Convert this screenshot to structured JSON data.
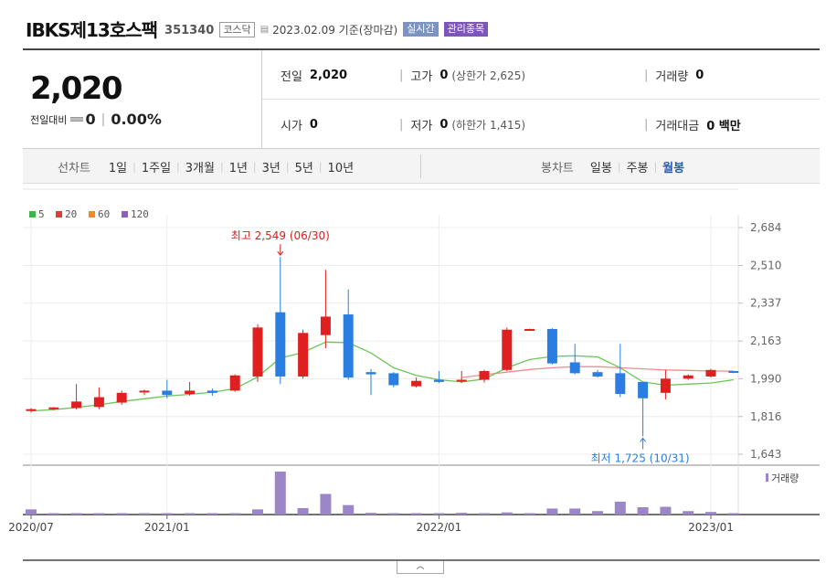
{
  "header": {
    "name": "IBKS제13호스팩",
    "code": "351340",
    "market": "코스닥",
    "date": "2023.02.09 기준(장마감)",
    "badge_realtime": "실시간",
    "badge_managed": "관리종목"
  },
  "quote": {
    "price": "2,020",
    "change_label": "전일대비",
    "change_value": "0",
    "change_separator": "|",
    "change_pct": "0.00%",
    "prev_close_label": "전일",
    "prev_close": "2,020",
    "high_label": "고가",
    "high": "0",
    "upper_limit": "(상한가 2,625)",
    "volume_label": "거래량",
    "volume": "0",
    "open_label": "시가",
    "open": "0",
    "low_label": "저가",
    "low": "0",
    "lower_limit": "(하한가 1,415)",
    "trade_value_label": "거래대금",
    "trade_value": "0 백만"
  },
  "period": {
    "line_label": "선차트",
    "line_items": [
      "1일",
      "1주일",
      "3개월",
      "1년",
      "3년",
      "5년",
      "10년"
    ],
    "candle_label": "봉차트",
    "candle_items": [
      "일봉",
      "주봉",
      "월봉"
    ],
    "active_candle": "월봉",
    "expand_icon": "chevron-up-icon"
  },
  "chart_data": {
    "type": "candlestick",
    "legend": [
      {
        "name": "5",
        "color": "#3cb54a"
      },
      {
        "name": "20",
        "color": "#e53935"
      },
      {
        "name": "60",
        "color": "#f5891f"
      },
      {
        "name": "120",
        "color": "#8e5bc7"
      }
    ],
    "up_color": "#e02020",
    "down_color": "#2a7de1",
    "y_ticks": [
      1643,
      1816,
      1990,
      2163,
      2337,
      2510,
      2684
    ],
    "y_tick_labels": [
      "1,643",
      "1,816",
      "1,990",
      "2,163",
      "2,337",
      "2,510",
      "2,684"
    ],
    "ylim": [
      1643,
      2684
    ],
    "x_labels": [
      {
        "index": 0,
        "label": "2020/07"
      },
      {
        "index": 6,
        "label": "2021/01"
      },
      {
        "index": 18,
        "label": "2022/01"
      },
      {
        "index": 30,
        "label": "2023/01"
      }
    ],
    "candles": [
      {
        "o": 1845,
        "h": 1855,
        "l": 1835,
        "c": 1850
      },
      {
        "o": 1850,
        "h": 1860,
        "l": 1845,
        "c": 1858
      },
      {
        "o": 1855,
        "h": 1965,
        "l": 1848,
        "c": 1885
      },
      {
        "o": 1860,
        "h": 1950,
        "l": 1850,
        "c": 1905
      },
      {
        "o": 1880,
        "h": 1935,
        "l": 1870,
        "c": 1925
      },
      {
        "o": 1930,
        "h": 1940,
        "l": 1915,
        "c": 1935
      },
      {
        "o": 1935,
        "h": 1985,
        "l": 1900,
        "c": 1915
      },
      {
        "o": 1920,
        "h": 1975,
        "l": 1912,
        "c": 1935
      },
      {
        "o": 1935,
        "h": 1945,
        "l": 1912,
        "c": 1925
      },
      {
        "o": 1935,
        "h": 2010,
        "l": 1930,
        "c": 2005
      },
      {
        "o": 2000,
        "h": 2240,
        "l": 1975,
        "c": 2225
      },
      {
        "o": 2295,
        "h": 2549,
        "l": 1965,
        "c": 2000
      },
      {
        "o": 2000,
        "h": 2215,
        "l": 1990,
        "c": 2200
      },
      {
        "o": 2190,
        "h": 2490,
        "l": 2130,
        "c": 2275
      },
      {
        "o": 2285,
        "h": 2400,
        "l": 1985,
        "c": 1995
      },
      {
        "o": 2020,
        "h": 2035,
        "l": 1915,
        "c": 2010
      },
      {
        "o": 2015,
        "h": 2020,
        "l": 1950,
        "c": 1960
      },
      {
        "o": 1955,
        "h": 1995,
        "l": 1950,
        "c": 1980
      },
      {
        "o": 1985,
        "h": 2025,
        "l": 1970,
        "c": 1975
      },
      {
        "o": 1980,
        "h": 2025,
        "l": 1970,
        "c": 1985
      },
      {
        "o": 1985,
        "h": 2030,
        "l": 1972,
        "c": 2025
      },
      {
        "o": 2030,
        "h": 2225,
        "l": 2025,
        "c": 2215
      },
      {
        "o": 2215,
        "h": 2220,
        "l": 2210,
        "c": 2218
      },
      {
        "o": 2218,
        "h": 2222,
        "l": 2055,
        "c": 2060
      },
      {
        "o": 2065,
        "h": 2150,
        "l": 2010,
        "c": 2015
      },
      {
        "o": 2020,
        "h": 2030,
        "l": 1995,
        "c": 2000
      },
      {
        "o": 2015,
        "h": 2150,
        "l": 1905,
        "c": 1920
      },
      {
        "o": 1975,
        "h": 1975,
        "l": 1725,
        "c": 1900
      },
      {
        "o": 1925,
        "h": 2030,
        "l": 1895,
        "c": 1990
      },
      {
        "o": 1990,
        "h": 2010,
        "l": 1985,
        "c": 2005
      },
      {
        "o": 2000,
        "h": 2035,
        "l": 1995,
        "c": 2030
      },
      {
        "o": 2025,
        "h": 2025,
        "l": 2015,
        "c": 2020
      }
    ],
    "ma5": [
      1842,
      1848,
      1858,
      1870,
      1885,
      1898,
      1910,
      1918,
      1928,
      1944,
      1998,
      2085,
      2110,
      2158,
      2155,
      2108,
      2040,
      2005,
      1985,
      1975,
      1988,
      2040,
      2078,
      2092,
      2095,
      2090,
      2040,
      1975,
      1960,
      1965,
      1970,
      1985
    ],
    "ma20": [
      null,
      null,
      null,
      null,
      null,
      null,
      null,
      null,
      null,
      null,
      null,
      null,
      null,
      null,
      null,
      null,
      null,
      null,
      null,
      1995,
      2008,
      2020,
      2032,
      2040,
      2045,
      2045,
      2040,
      2035,
      2030,
      2028,
      2025,
      2025
    ],
    "max_label": "최고 2,549 (06/30)",
    "max_index": 11,
    "max_value": 2549,
    "min_label": "최저 1,725 (10/31)",
    "min_index": 27,
    "min_value": 1725,
    "volume_label": "거래량",
    "volume_color": "#9b86c7",
    "volume": [
      12,
      3,
      3,
      3,
      0,
      3,
      0,
      0,
      0,
      0,
      12,
      100,
      15,
      48,
      22,
      4,
      3,
      3,
      0,
      4,
      0,
      5,
      0,
      14,
      14,
      8,
      30,
      17,
      18,
      8,
      6,
      3
    ]
  }
}
